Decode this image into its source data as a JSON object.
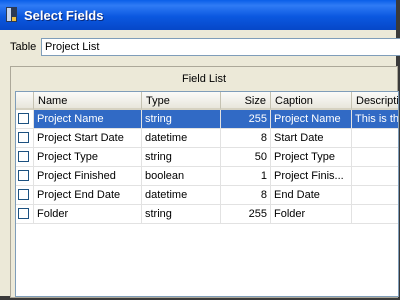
{
  "window": {
    "title": "Select Fields"
  },
  "table_field": {
    "label": "Table",
    "value": "Project List"
  },
  "field_list": {
    "title": "Field List",
    "columns": [
      "Name",
      "Type",
      "Size",
      "Caption",
      "Descripti"
    ],
    "rows": [
      {
        "name": "Project Name",
        "type": "string",
        "size": "255",
        "caption": "Project Name",
        "description": "This is th",
        "checked": false,
        "selected": true
      },
      {
        "name": "Project Start Date",
        "type": "datetime",
        "size": "8",
        "caption": "Start Date",
        "description": "",
        "checked": false,
        "selected": false
      },
      {
        "name": "Project Type",
        "type": "string",
        "size": "50",
        "caption": "Project Type",
        "description": "",
        "checked": false,
        "selected": false
      },
      {
        "name": "Project Finished",
        "type": "boolean",
        "size": "1",
        "caption": "Project Finis...",
        "description": "",
        "checked": false,
        "selected": false
      },
      {
        "name": "Project End Date",
        "type": "datetime",
        "size": "8",
        "caption": "End Date",
        "description": "",
        "checked": false,
        "selected": false
      },
      {
        "name": "Folder",
        "type": "string",
        "size": "255",
        "caption": "Folder",
        "description": "",
        "checked": false,
        "selected": false
      }
    ]
  },
  "colors": {
    "titlebar": "#0b58e0",
    "selection": "#316ac5",
    "window_bg": "#ece9d8"
  }
}
